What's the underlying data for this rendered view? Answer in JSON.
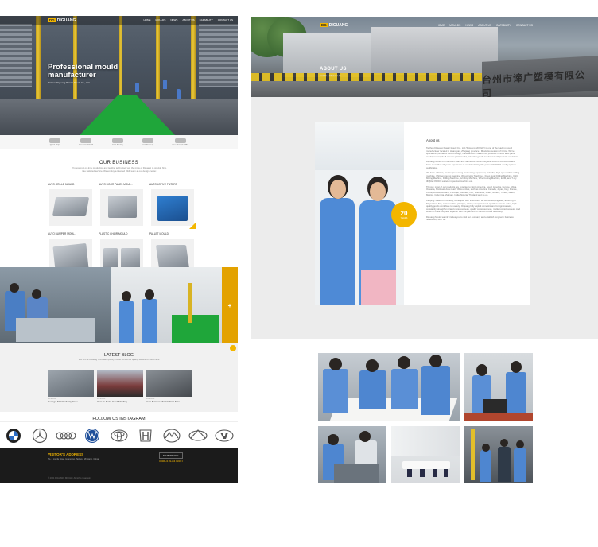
{
  "colors": {
    "accent": "#f3b600",
    "dark": "#1b1b1b",
    "green": "#1fa63a"
  },
  "left_page": {
    "nav": {
      "logo_text": "DIGUANG",
      "links": [
        "HOME",
        "MOULDS",
        "NEWS",
        "ABOUT US",
        "CAPABILITY",
        "CONTACT US"
      ]
    },
    "hero": {
      "title": "Professional mould manufacturer",
      "subtitle": "Taizhou Diguang Plastic Mould Co., Ltd."
    },
    "hero_icons": [
      "Quick Ship",
      "Precision Mould",
      "Cost Saving",
      "Fast Delivery",
      "Free Sample Offer"
    ],
    "business": {
      "title": "OUR BUSINESS",
      "description": "Professional on-time production and leading technology are the pride of Diguang to provide first-rate satisfied service. We employ a talented R&D team at our design center.",
      "cards": [
        {
          "label": "AUTO GRILLE MOULD"
        },
        {
          "label": "AUTO DOOR PANEL MOUL..."
        },
        {
          "label": "AUTOMOTIVE FILTERS"
        },
        {
          "label": "AUTO BUMPER MOUL..."
        },
        {
          "label": "PLASTIC CHAIR MOULD"
        },
        {
          "label": "PALLET MOULD"
        }
      ]
    },
    "workers_section": {
      "more_symbol": "+"
    },
    "blog": {
      "title": "LATEST BLOG",
      "description": "We aim at creating first-class quality mould as well as quality service to customers.",
      "posts": [
        {
          "date": "10-26-21",
          "title": "Guangxi Mold Industry Grou..."
        },
        {
          "date": "10-26-21",
          "title": "How To Make Good Molding"
        },
        {
          "date": "10-26-21",
          "title": "Auto Bumper Mould China Man..."
        }
      ]
    },
    "follow": {
      "title": "FOLLOW US  INSTAGRAM",
      "description": "Diguang Mould's photos on Instagram."
    },
    "brands": [
      "bmw-logo",
      "mercedes-logo",
      "audi-logo",
      "volkswagen-logo",
      "toyota-logo",
      "honda-logo",
      "mazda-logo",
      "infiniti-logo",
      "hyundai-logo"
    ],
    "footer": {
      "title": "VISITOR'S ADDRESS",
      "address": "No. 8 Lianfa Road, Huangyan, Taizhou, Zhejiang, China",
      "button": "TV MESSAGE",
      "phone": "0086-576-84765577",
      "copyright": "© 2021 DIGUANG MOULD. All rights reserved."
    }
  },
  "right_page": {
    "nav": {
      "logo_text": "DIGUANG",
      "links": [
        "HOME",
        "MOULDS",
        "NEWS",
        "ABOUT US",
        "CAPABILITY",
        "CONTACT US"
      ]
    },
    "hero": {
      "title": "ABOUT US",
      "breadcrumb": "HOME / ABOUT US",
      "sign_text": "台州市谛广塑模有限公司"
    },
    "about": {
      "heading": "About us",
      "paragraphs": [
        "Taizhou Diguang Plastic Mould Co., Ltd ('Diguang MOULD') is one of the leading mould manufacturer located in Huangyan, Zhejiang province - Mould Hometown of China. We're specializing at plastic mould design, manufacture & sales. Our products include auto parts mould, motorcycle & scooter parts mould, industrial goods and household products mould etc.",
        "Diguang Mould is an efficient team and has about 100 employees. Most of our technicians have more than 10 years experience in mould industry. We passed ISO9001 quality system certification.",
        "We have efficient, precise processing and testing equipment, including high speed CNC milling machine, CNC engraving machine, Wired-cutter Machines, Deep Hole Drilling Machine, CNC Milling Machine, Drilling Machine, Grinding Machine, Wire Cutting Machine, EDM, and T-ray 3D(Ray 8000z) surface inspection machine etc.",
        "Till now, most of our products are exported to North America, South America, Europe, Africa, Oceania, Mid-East, Asia nearly 30 countries, such as America, Canada, Japan, Italy, France, Korea, Russia, Holland, Portugal, Australia, Iran, Indonesia, Spain, Greece, Turkey, Brazil, Mexico, Columbia, Vietnam, India, Nigeria, Thailand and so on.",
        "Keeping 'Based on honesty, developed with Innovation' as our developing idea, adhering to 'Reputation first, customer first' principle, taking enterprise level 'quality to create value, high quality goods contribute to society'. Diguang fully exploit domestic and foreign markets, constantly strengthen brand consciousness, quality consciousness, market consciousness. And strive to make progress together with the partners of various circles of society.",
        "Diguang Mould warmly invites you to visit our company and establish long-term business relationship with us."
      ],
      "years_number": "20",
      "years_unit": "YEARS"
    }
  }
}
